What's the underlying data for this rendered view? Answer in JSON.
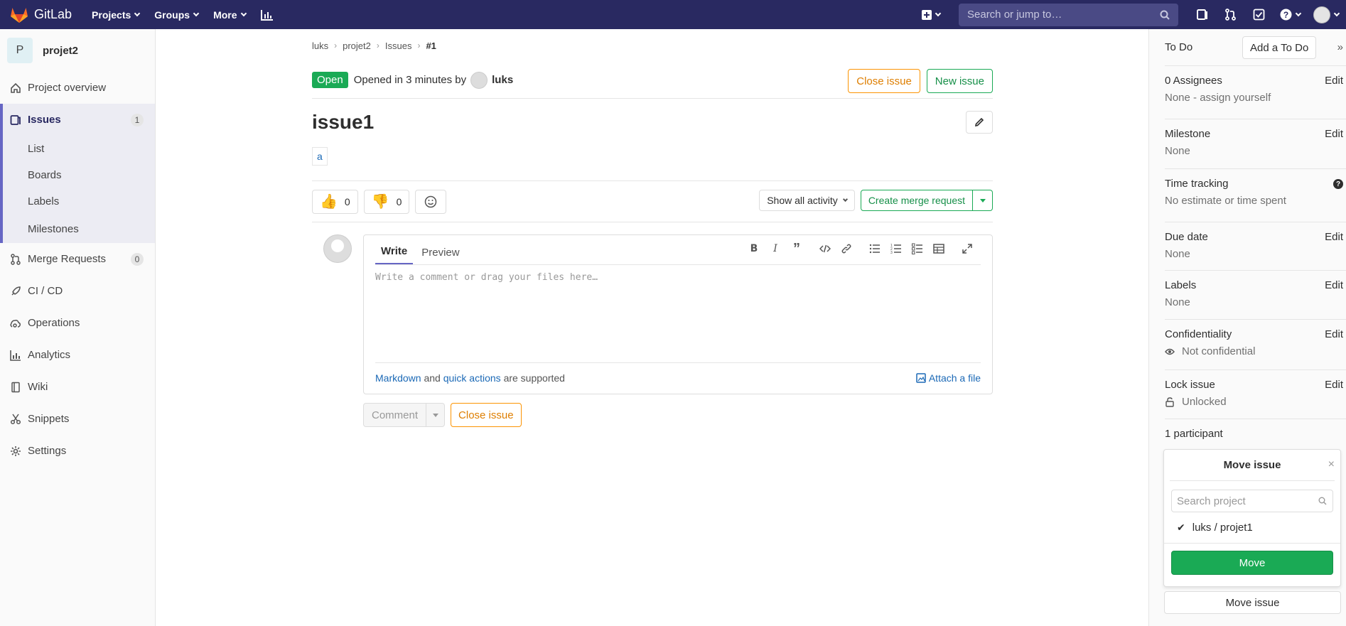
{
  "topnav": {
    "brand": "GitLab",
    "menu": [
      {
        "label": "Projects"
      },
      {
        "label": "Groups"
      },
      {
        "label": "More"
      }
    ],
    "search_placeholder": "Search or jump to…"
  },
  "sidebar": {
    "project_initial": "P",
    "project_name": "projet2",
    "items": {
      "overview": "Project overview",
      "issues": "Issues",
      "issues_count": "1",
      "list": "List",
      "boards": "Boards",
      "labels": "Labels",
      "milestones": "Milestones",
      "merge_requests": "Merge Requests",
      "mr_count": "0",
      "cicd": "CI / CD",
      "operations": "Operations",
      "analytics": "Analytics",
      "wiki": "Wiki",
      "snippets": "Snippets",
      "settings": "Settings"
    }
  },
  "breadcrumb": [
    "luks",
    "projet2",
    "Issues",
    "#1"
  ],
  "issue": {
    "status": "Open",
    "opened_text": "Opened in 3 minutes by",
    "author": "luks",
    "close_label": "Close issue",
    "new_label": "New issue",
    "title": "issue1",
    "description_link": "a",
    "thumbs_up": "0",
    "thumbs_down": "0",
    "activity_label": "Show all activity",
    "create_mr_label": "Create merge request"
  },
  "editor": {
    "tab_write": "Write",
    "tab_preview": "Preview",
    "placeholder": "Write a comment or drag your files here…",
    "markdown_link": "Markdown",
    "and_text": "and",
    "quick_actions_link": "quick actions",
    "supported_text": "are supported",
    "attach_label": "Attach a file",
    "comment_label": "Comment",
    "close_label": "Close issue"
  },
  "right_sidebar": {
    "todo_label": "To Do",
    "add_todo": "Add a To Do",
    "edit_label": "Edit",
    "assignees_title": "0 Assignees",
    "assignees_value": "None -",
    "assign_yourself": "assign yourself",
    "milestone_title": "Milestone",
    "milestone_value": "None",
    "time_title": "Time tracking",
    "time_value": "No estimate or time spent",
    "due_title": "Due date",
    "due_value": "None",
    "labels_title": "Labels",
    "labels_value": "None",
    "conf_title": "Confidentiality",
    "conf_value": "Not confidential",
    "lock_title": "Lock issue",
    "lock_value": "Unlocked",
    "participants": "1 participant",
    "move_title": "Move issue",
    "move_search_placeholder": "Search project",
    "move_project": "luks / projet1",
    "move_button": "Move",
    "move_issue_button": "Move issue"
  },
  "colors": {
    "nav_bg": "#292961",
    "success": "#1aaa55",
    "warning": "#fc9403",
    "link": "#1b69b6"
  }
}
